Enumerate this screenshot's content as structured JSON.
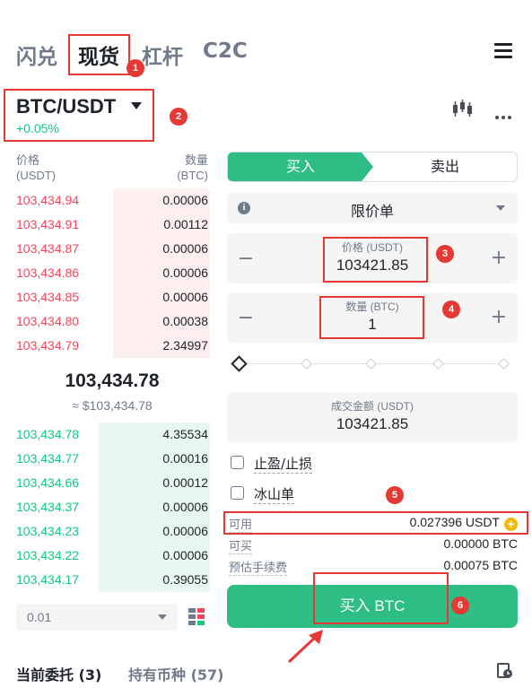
{
  "top_tabs": [
    "闪兑",
    "现货",
    "杠杆",
    "C2C"
  ],
  "pair": {
    "name": "BTC/USDT",
    "change": "+0.05%"
  },
  "order_book": {
    "price_header": [
      "价格",
      "(USDT)"
    ],
    "qty_header": [
      "数量",
      "(BTC)"
    ],
    "asks": [
      {
        "price": "103,434.94",
        "qty": "0.00006",
        "depth": 0.5
      },
      {
        "price": "103,434.91",
        "qty": "0.00112",
        "depth": 0.5
      },
      {
        "price": "103,434.87",
        "qty": "0.00006",
        "depth": 0.5
      },
      {
        "price": "103,434.86",
        "qty": "0.00006",
        "depth": 0.5
      },
      {
        "price": "103,434.85",
        "qty": "0.00006",
        "depth": 0.5
      },
      {
        "price": "103,434.80",
        "qty": "0.00038",
        "depth": 0.5
      },
      {
        "price": "103,434.79",
        "qty": "2.34997",
        "depth": 0.5
      }
    ],
    "last_price": "103,434.78",
    "last_price_usd": "≈ $103,434.78",
    "bids": [
      {
        "price": "103,434.78",
        "qty": "4.35534",
        "depth": 0.58
      },
      {
        "price": "103,434.77",
        "qty": "0.00016",
        "depth": 0.58
      },
      {
        "price": "103,434.66",
        "qty": "0.00012",
        "depth": 0.58
      },
      {
        "price": "103,434.37",
        "qty": "0.00006",
        "depth": 0.58
      },
      {
        "price": "103,434.23",
        "qty": "0.00006",
        "depth": 0.58
      },
      {
        "price": "103,434.22",
        "qty": "0.00006",
        "depth": 0.58
      },
      {
        "price": "103,434.17",
        "qty": "0.39055",
        "depth": 0.58
      }
    ],
    "depth_value": "0.01"
  },
  "trade": {
    "buy_label": "买入",
    "sell_label": "卖出",
    "order_type": "限价单",
    "price_label": "价格 (USDT)",
    "price_value": "103421.85",
    "amount_label": "数量 (BTC)",
    "amount_value": "1",
    "total_label": "成交金额 (USDT)",
    "total_value": "103421.85",
    "tp_sl_label": "止盈/止损",
    "iceberg_label": "冰山单",
    "available_label": "可用",
    "available_value": "0.027396 USDT",
    "can_buy_label": "可买",
    "can_buy_value": "0.00000 BTC",
    "fee_label": "预估手续费",
    "fee_value": "0.00075 BTC",
    "submit_label": "买入 BTC"
  },
  "bottom_tabs": {
    "open_orders": "当前委托 (3)",
    "holdings": "持有币种 (57)"
  },
  "badges": [
    "1",
    "2",
    "3",
    "4",
    "5",
    "6"
  ],
  "colors": {
    "green": "#2ebd85",
    "red": "#f6465d",
    "highlight": "#e53935",
    "gold": "#f0b90b"
  }
}
